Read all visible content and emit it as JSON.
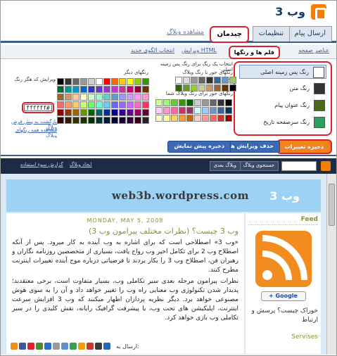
{
  "app": {
    "title": "وب 3"
  },
  "tabs": [
    {
      "label": "ارسال پیام"
    },
    {
      "label": "تنظیمات"
    },
    {
      "label": "چیدمان"
    },
    {
      "label": "مشاهده وبلاگ"
    }
  ],
  "subtabs": [
    {
      "label": "عناصر صفحه"
    },
    {
      "label": "قلم ها و رنگها"
    },
    {
      "label": "ویرایش HTML"
    },
    {
      "label": "انتخاب الگوی جدید"
    }
  ],
  "elements": [
    {
      "label": "رنگ پس زمینه اصلی",
      "color": "#ffffff"
    },
    {
      "label": "رنگ متن",
      "color": "#333333"
    },
    {
      "label": "رنگ عنوان پیام",
      "color": "#4b6a17"
    },
    {
      "label": "رنگ سرصفحه تاریخ",
      "color": "#2aa060"
    }
  ],
  "colors_panel": {
    "head_right_1": "انتخاب یک رنگ برای رنگ پس زمینه اصلی",
    "head_right_2": "رنگهای جور با رنگ وبلاگ شما",
    "head_right_3": "رنگهای جور برای رنگ وبلاگ شما",
    "head_mid": "رنگهای دیگر",
    "head_left": "ویرایش کد هگز رنگ",
    "hex_value": "ffffff#",
    "link_1": "بازگشت به پیش فرض وبلاگ",
    "link_2": "مشاهده همه رنگهای وبلاگ"
  },
  "buttons": {
    "save": "ذخیره تغییرات",
    "clear": "حذف ویرایش ها",
    "ghost": "ذخیره پیش نمایش"
  },
  "navbar": {
    "btn_1": "جستجوی وبلاگ",
    "btn_2": "وبلاگ بعدی",
    "link_1": "گزارش سوء استفاده",
    "link_2": "ایجاد وبلاگ"
  },
  "preview": {
    "watermark": "web3b.wordpress.com",
    "blog_title": "وب 3",
    "date": "MONDAY, MAY 5, 2008",
    "post_title": "وب 3 چیست؟ (نظرات مختلف پیرامون وب 3)",
    "body_1": "«وب 3» اصطلاحی است که برای اشاره به وب آینده به کار میرود. پس از آنکه اصطلاح وب 2 برای تکامل اخیر وب رواج یافت، بسیاری از متخصصین روزنامه نگاران و رهبران فن، اصطلاح وب 3 را بکار بردند تا فرضیاتی درباره موج آینده تغییرات اینترنت مطرح کنند.",
    "body_2": "نظرات پیرامون مرحله بعدی سیر تکاملی وب، بسیار متفاوت است، برخی معتقدند؛ پدیدار شدن تکنولوژی وب معنایی راه وب را تغییر خواهد داد و آن را به سوی هوش مصنوعی خواهد برد. دیگر نظریه پردازان اظهار میکنند که وب 3 افزایش سرعت اینترنت، اپلیکیشن های تحت وب، یا پیشرفت گرافیک رایانه، نقش کلیدی را در سیر تکاملی وب بازی خواهد کرد.",
    "share_label": "ارسال به:",
    "side_feed": "Feed",
    "side_google": "+ Google",
    "side_text": "خوراک چیست؟ پرسش و ارتباط",
    "side_services": "Servises"
  }
}
